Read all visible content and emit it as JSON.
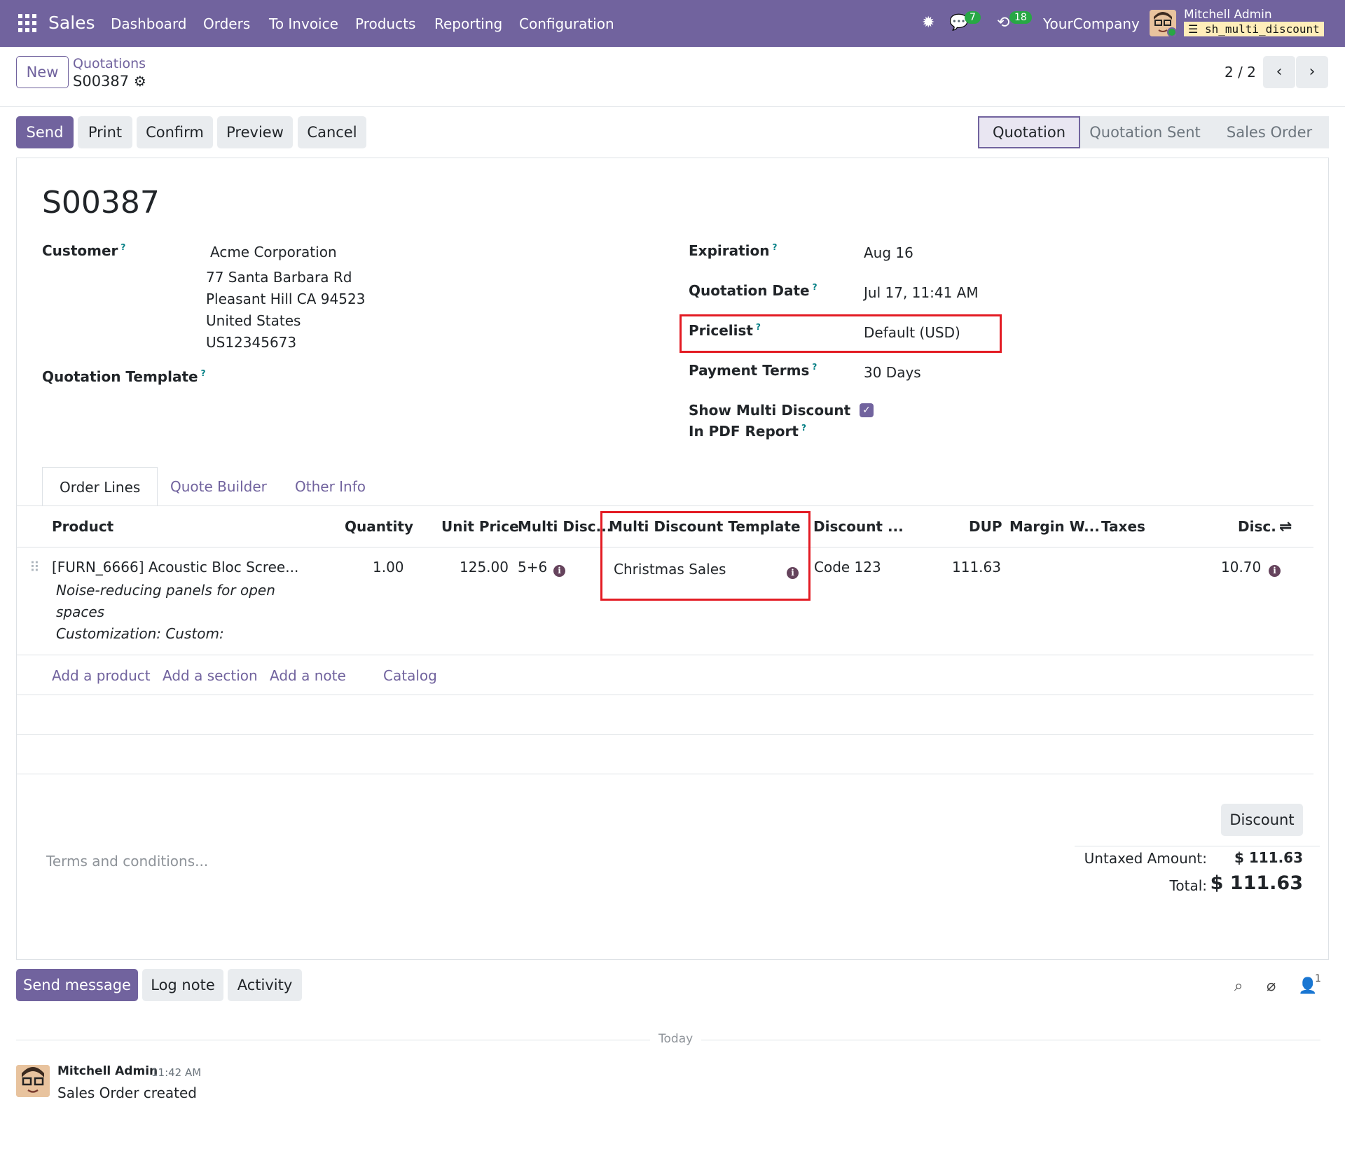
{
  "nav": {
    "app": "Sales",
    "menus": [
      "Dashboard",
      "Orders",
      "To Invoice",
      "Products",
      "Reporting",
      "Configuration"
    ],
    "messages_count": "7",
    "activities_count": "18",
    "company": "YourCompany",
    "user": "Mitchell Admin",
    "database": "sh_multi_discount"
  },
  "control": {
    "new_label": "New",
    "breadcrumb": "Quotations",
    "record": "S00387",
    "pager": "2 / 2"
  },
  "actions": {
    "send": "Send",
    "print": "Print",
    "confirm": "Confirm",
    "preview": "Preview",
    "cancel": "Cancel"
  },
  "stages": [
    "Quotation",
    "Quotation Sent",
    "Sales Order"
  ],
  "form": {
    "title": "S00387",
    "customer_label": "Customer",
    "customer_name": "Acme Corporation",
    "customer_address": [
      "77 Santa Barbara Rd",
      "Pleasant Hill CA 94523",
      "United States",
      "US12345673"
    ],
    "template_label": "Quotation Template",
    "expiration_label": "Expiration",
    "expiration": "Aug 16",
    "quotation_date_label": "Quotation Date",
    "quotation_date": "Jul 17, 11:41 AM",
    "pricelist_label": "Pricelist",
    "pricelist": "Default (USD)",
    "payment_terms_label": "Payment Terms",
    "payment_terms": "30 Days",
    "show_multi_label_1": "Show Multi Discount",
    "show_multi_label_2": "In PDF Report",
    "show_multi_checked": true
  },
  "tabs": [
    "Order Lines",
    "Quote Builder",
    "Other Info"
  ],
  "table": {
    "headers": {
      "product": "Product",
      "quantity": "Quantity",
      "unit_price": "Unit Price",
      "multi_disc": "Multi Disc...",
      "multi_template": "Multi Discount Template",
      "discount_code": "Discount ...",
      "dup": "DUP",
      "margin": "Margin W...",
      "taxes": "Taxes",
      "disc": "Disc."
    },
    "row": {
      "product": "[FURN_6666] Acoustic Bloc Scree...",
      "desc_1": "Noise-reducing panels for open",
      "desc_2": "spaces",
      "desc_3": "Customization: Custom:",
      "quantity": "1.00",
      "unit_price": "125.00",
      "multi_disc": "5+6",
      "multi_template": "Christmas Sales",
      "discount_code": "Code 123",
      "dup": "111.63",
      "disc": "10.70"
    },
    "add_product": "Add a product",
    "add_section": "Add a section",
    "add_note": "Add a note",
    "catalog": "Catalog"
  },
  "footer": {
    "terms_placeholder": "Terms and conditions...",
    "discount_button": "Discount",
    "untaxed_label": "Untaxed Amount:",
    "untaxed_value": "$ 111.63",
    "total_label": "Total:",
    "total_value": "$ 111.63"
  },
  "chatter": {
    "send_message": "Send message",
    "log_note": "Log note",
    "activity": "Activity",
    "followers_count": "1",
    "today": "Today",
    "author": "Mitchell Admin",
    "time": "11:42 AM",
    "body": "Sales Order created"
  },
  "colors": {
    "brand": "#71639e",
    "highlight": "#e31b23",
    "badge": "#28a745"
  }
}
